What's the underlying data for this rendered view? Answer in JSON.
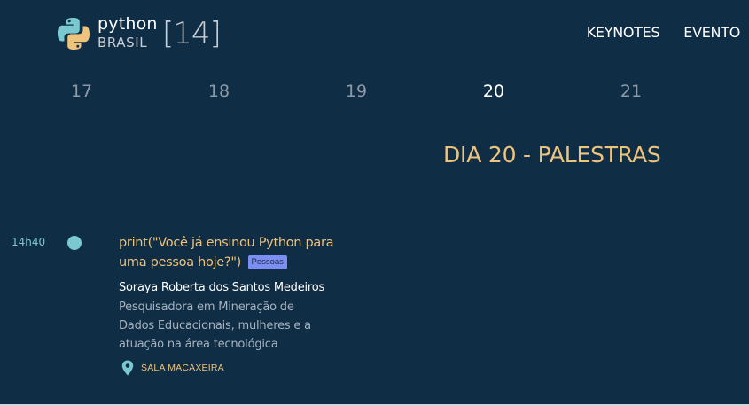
{
  "header": {
    "logo": {
      "word1": "python",
      "word2": "BRASIL",
      "number": "[14]"
    },
    "nav": [
      {
        "label": "KEYNOTES"
      },
      {
        "label": "EVENTO"
      }
    ]
  },
  "days": {
    "items": [
      "17",
      "18",
      "19",
      "20",
      "21"
    ],
    "active": "20"
  },
  "section_title": "DIA 20 - PALESTRAS",
  "talk": {
    "time": "14h40",
    "title": "print(\"Você já ensinou Python para uma pessoa hoje?\")",
    "tag": "Pessoas",
    "speaker": "Soraya Roberta dos Santos Medeiros",
    "bio": "Pesquisadora em Mineração de Dados Educacionais, mulheres e a atuação na área tecnológica",
    "location": "SALA MACAXEIRA"
  },
  "colors": {
    "background": "#0f2d45",
    "accent_yellow": "#eec37c",
    "accent_teal": "#7ac9d0",
    "tag_bg": "#7b8ef1",
    "muted_text": "#a7b2bd"
  },
  "icons": {
    "logo": "python-logo-icon",
    "location": "map-pin-icon"
  }
}
